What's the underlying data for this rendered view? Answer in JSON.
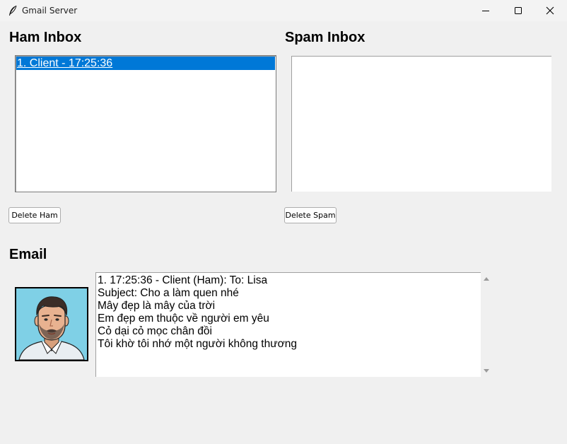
{
  "window": {
    "title": "Gmail Server",
    "icon": "feather-icon"
  },
  "ham": {
    "heading": "Ham Inbox",
    "items": [
      "1. Client - 17:25:36"
    ],
    "selected_index": 0,
    "delete_label": "Delete Ham"
  },
  "spam": {
    "heading": "Spam Inbox",
    "items": [],
    "delete_label": "Delete Spam"
  },
  "email": {
    "heading": "Email",
    "avatar": "avatar-man-beard",
    "lines": [
      "1. 17:25:36 - Client (Ham): To: Lisa",
      "Subject: Cho a làm quen nhé",
      "Mây đẹp là mây của trời",
      "Em đẹp em thuộc về người em yêu",
      "Cỏ dại cỏ mọc chân đồi",
      "Tôi khờ tôi nhớ một người không thương"
    ]
  },
  "colors": {
    "selection": "#0078d7",
    "background": "#f0f0f0",
    "avatar_bg": "#7fd0e6"
  }
}
